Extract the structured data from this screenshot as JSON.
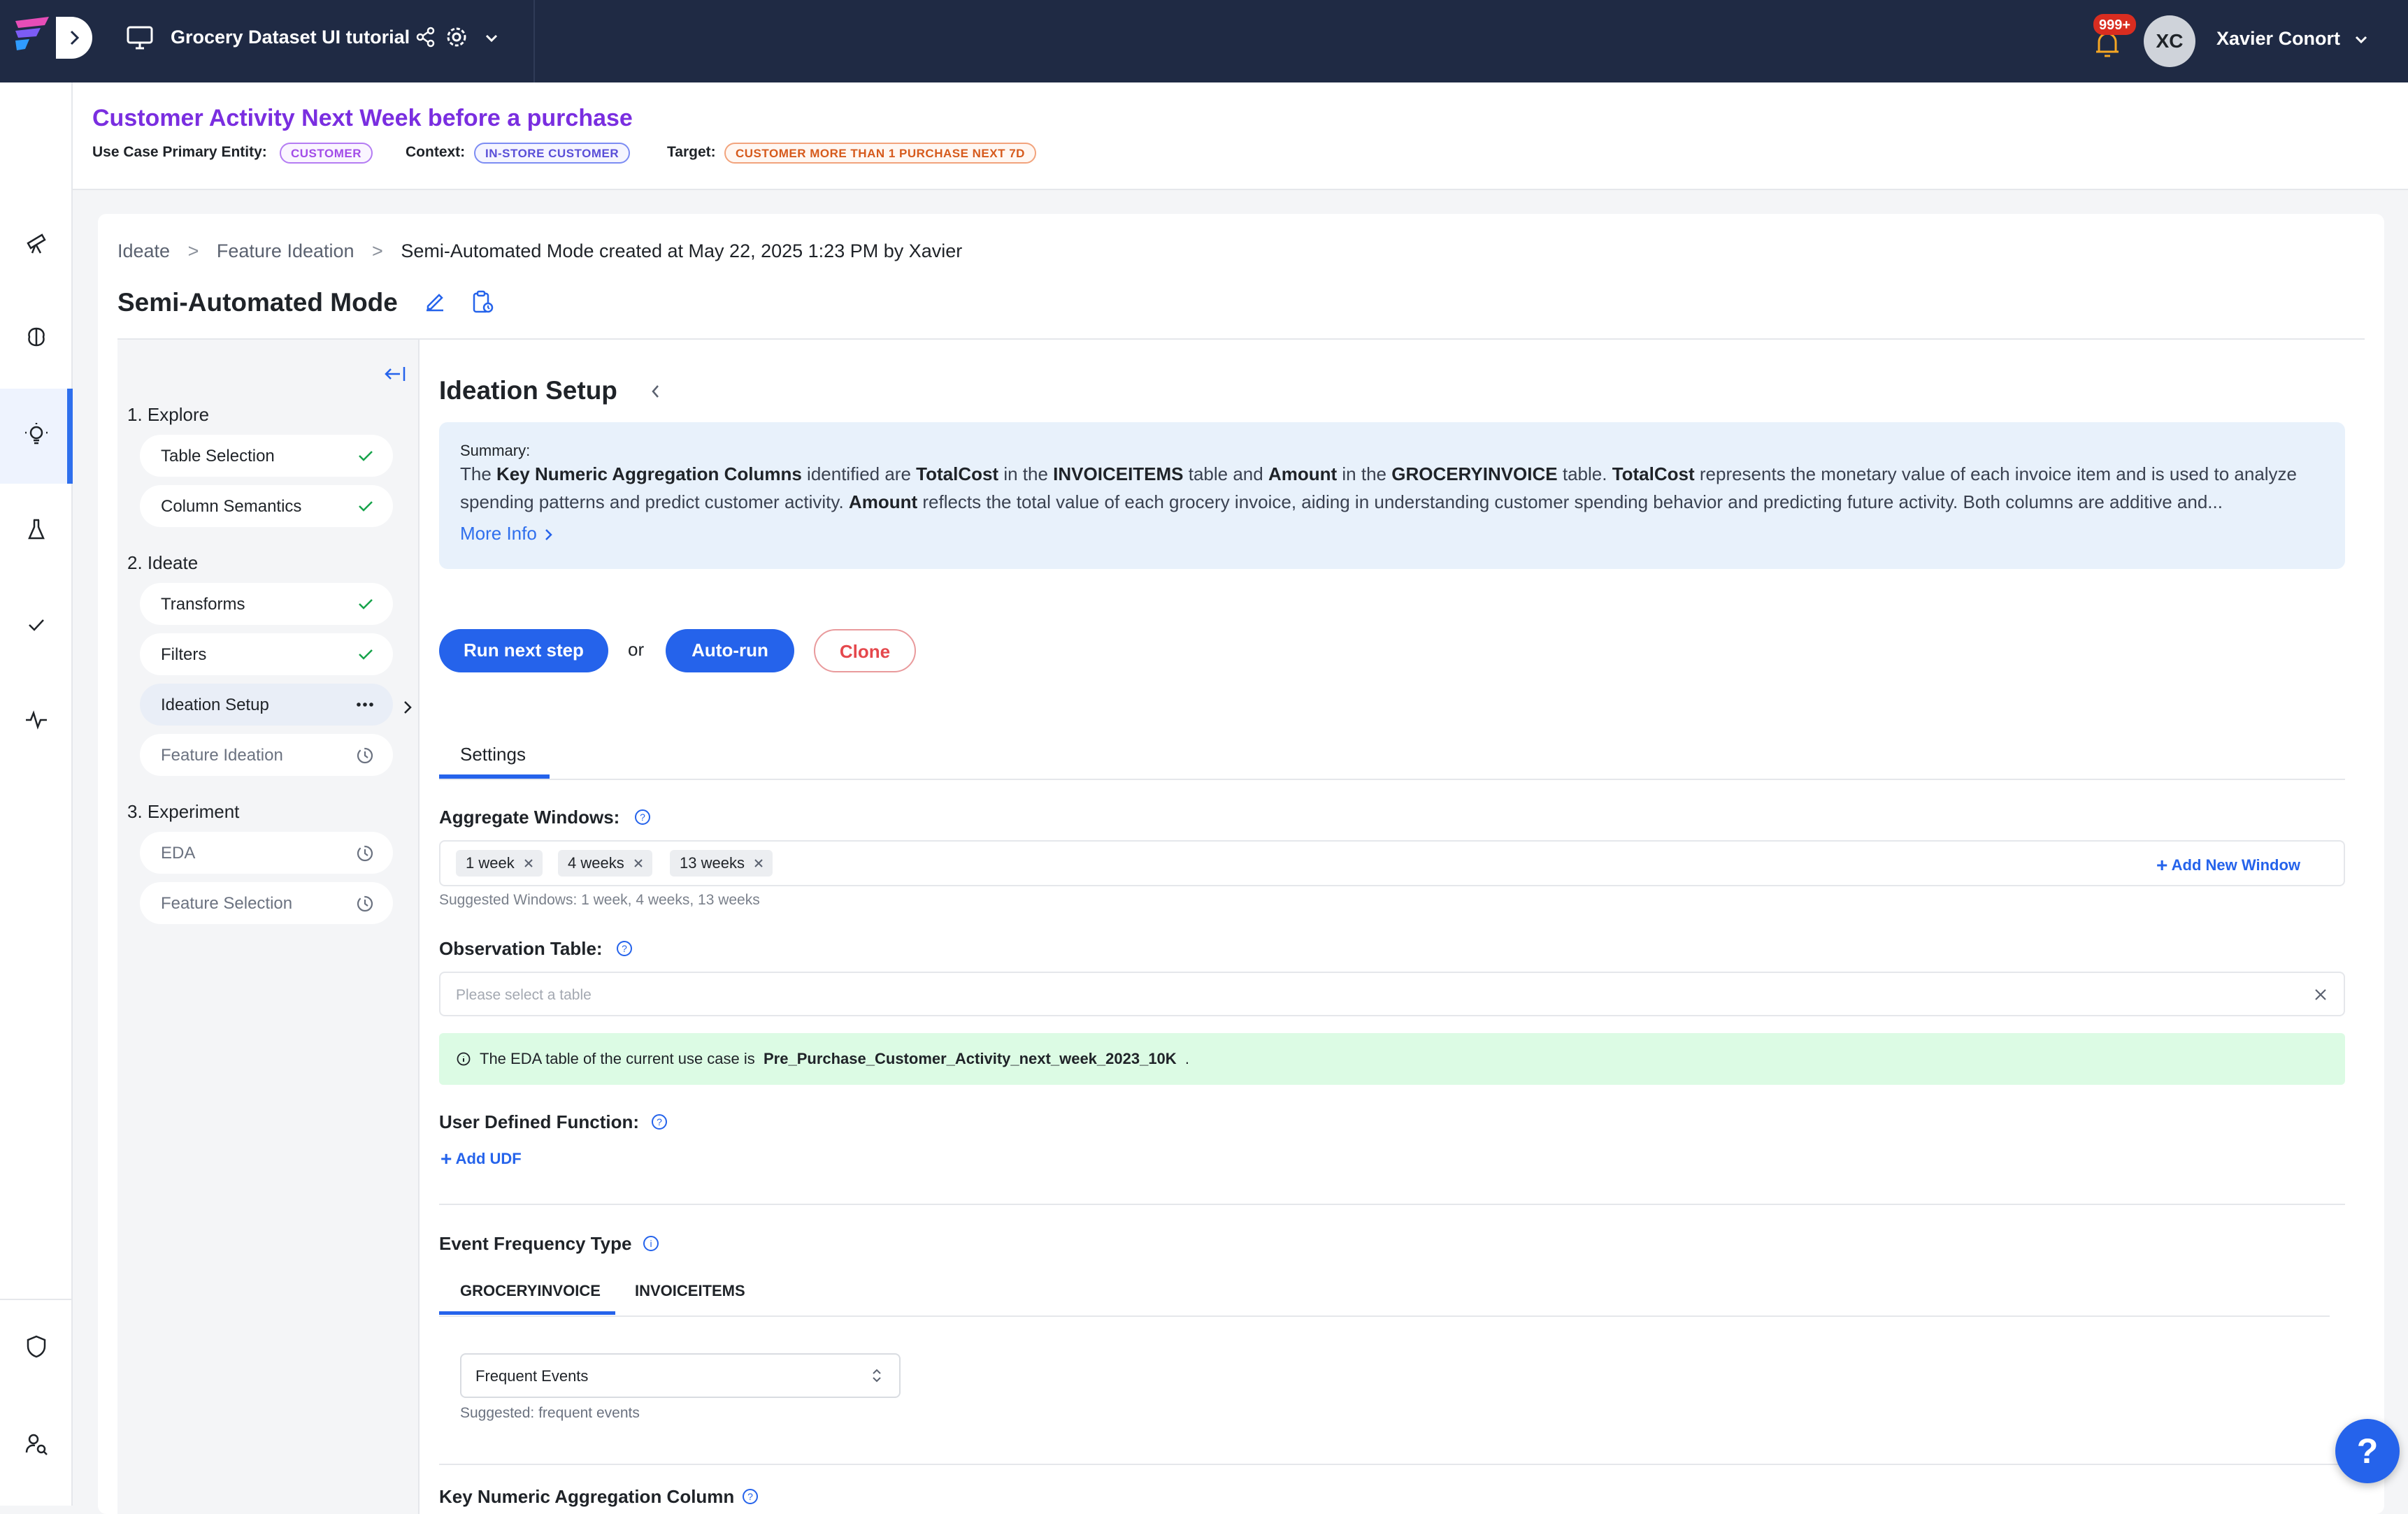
{
  "topbar": {
    "project_title": "Grocery Dataset UI tutorial",
    "notification_count": "999+",
    "user_initials": "XC",
    "user_name": "Xavier Conort"
  },
  "use_case": {
    "title": "Customer Activity Next Week before a purchase",
    "entity_label": "Use Case Primary Entity:",
    "entity_tag": "CUSTOMER",
    "context_label": "Context:",
    "context_tag": "IN-STORE CUSTOMER",
    "target_label": "Target:",
    "target_tag": "CUSTOMER MORE THAN 1 PURCHASE NEXT 7D"
  },
  "breadcrumbs": [
    "Ideate",
    ">",
    "Feature Ideation",
    ">",
    "Semi-Automated Mode created at May 22, 2025 1:23 PM by Xavier"
  ],
  "page_title": "Semi-Automated Mode",
  "steps": {
    "explore": "1. Explore",
    "ideate": "2. Ideate",
    "experiment": "3. Experiment",
    "items": {
      "table_selection": "Table Selection",
      "column_semantics": "Column Semantics",
      "transforms": "Transforms",
      "filters": "Filters",
      "ideation_setup": "Ideation Setup",
      "feature_ideation": "Feature Ideation",
      "eda": "EDA",
      "feature_selection": "Feature Selection"
    }
  },
  "setup": {
    "title": "Ideation Setup",
    "summary_label": "Summary:",
    "summary_parts": {
      "p1": "The ",
      "b1": "Key Numeric Aggregation Columns",
      "p2": " identified are ",
      "b2": "TotalCost",
      "p3": " in the ",
      "b3": "INVOICEITEMS",
      "p4": " table and ",
      "b4": "Amount",
      "p5": " in the ",
      "b5": "GROCERYINVOICE",
      "p6": " table. ",
      "b6": "TotalCost",
      "p7": " represents the monetary value of each invoice item and is used to analyze spending patterns and predict customer activity. ",
      "b7": "Amount",
      "p8": " reflects the total value of each grocery invoice, aiding in understanding customer spending behavior and predicting future activity. Both columns are additive and..."
    },
    "more_info": "More Info",
    "run_next": "Run next step",
    "or": "or",
    "auto_run": "Auto-run",
    "clone": "Clone",
    "tab_settings": "Settings"
  },
  "settings": {
    "aggregate_windows_label": "Aggregate Windows:",
    "windows": [
      "1 week",
      "4 weeks",
      "13 weeks"
    ],
    "add_window": "Add New Window",
    "suggested_windows": "Suggested Windows: 1 week, 4 weeks, 13 weeks",
    "observation_table_label": "Observation Table:",
    "observation_placeholder": "Please select a table",
    "eda_prefix": "The EDA table of the current use case is",
    "eda_table": "Pre_Purchase_Customer_Activity_next_week_2023_10K",
    "eda_suffix": ".",
    "udf_label": "User Defined Function:",
    "add_udf": "Add UDF",
    "event_freq_label": "Event Frequency Type",
    "event_tabs": [
      "GROCERYINVOICE",
      "INVOICEITEMS"
    ],
    "event_value": "Frequent Events",
    "event_suggested": "Suggested: frequent events",
    "key_numeric_label": "Key Numeric Aggregation Column"
  },
  "help_fab": "?",
  "colors": {
    "accent": "#2563eb",
    "topbar": "#1f2a44",
    "title_purple": "#7a2ee0",
    "success": "#16a34a",
    "danger": "#e5484d"
  }
}
